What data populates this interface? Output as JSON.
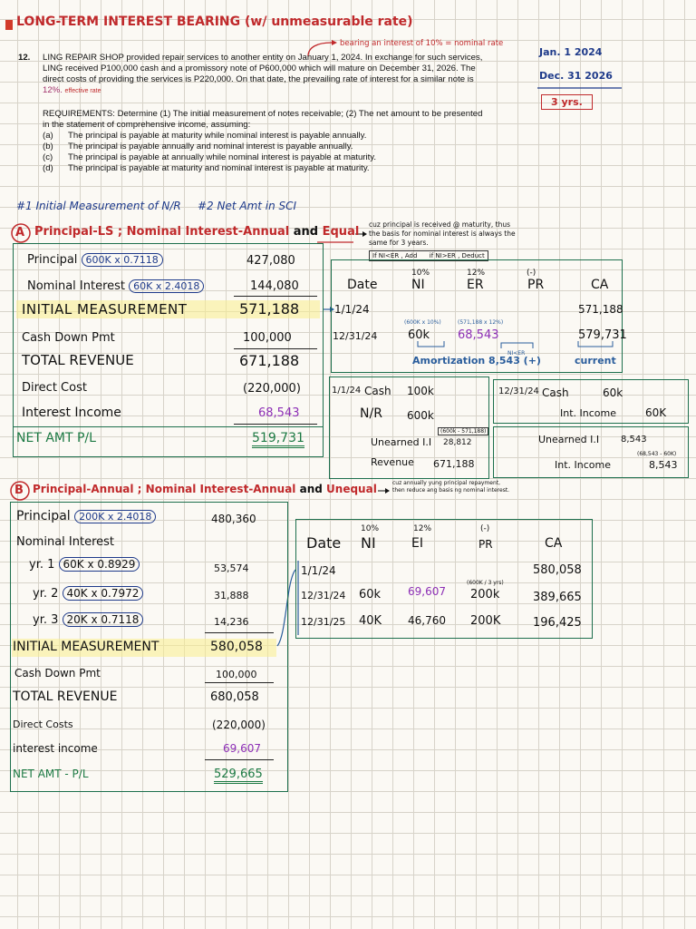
{
  "header": {
    "title": "LONG-TERM INTEREST BEARING",
    "subtitle": "(w/ unmeasurable rate)",
    "annotation": "bearing an interest of 10% = nominal rate",
    "dates": [
      "Jan. 1 2024",
      "Dec. 31 2026"
    ],
    "years": "3 yrs."
  },
  "problem": {
    "number": "12.",
    "lines": [
      "LING REPAIR SHOP provided repair services to another entity on January 1, 2024. In exchange for such services,",
      "LING received P100,000 cash and a promissory note of P600,000 which will mature on December 31, 2026. The",
      "direct costs of providing the services is P220,000. On that date, the prevailing rate of interest for a similar note is",
      "12%."
    ],
    "effective_note": "effective rate",
    "req_lines": [
      "REQUIREMENTS: Determine (1) The initial measurement of notes receivable; (2) The net amount to be presented",
      "in the statement of comprehensive income, assuming:"
    ],
    "options": [
      {
        "k": "(a)",
        "t": "The principal is payable at maturity while nominal interest is payable annually."
      },
      {
        "k": "(b)",
        "t": "The principal is payable annually and nominal interest is payable annually."
      },
      {
        "k": "(c)",
        "t": "The principal is payable at annually while nominal interest is payable at maturity."
      },
      {
        "k": "(d)",
        "t": "The principal is payable at maturity and nominal interest is payable at maturity."
      }
    ]
  },
  "section_headers": {
    "h1": "#1 Initial Measurement of N/R",
    "h2": "#2 Net Amt in SCI"
  },
  "partA": {
    "letter": "A",
    "title": "Principal-LS ; Nominal Interest-Annual",
    "and": "and",
    "equal": "Equal",
    "note": [
      "cuz principal is received @ maturity, thus",
      "the basis for nominal interest is always the",
      "same for 3 years."
    ],
    "mini_rule": [
      "If NI<ER , Add",
      "if NI>ER , Deduct"
    ],
    "rows": [
      {
        "label": "Principal",
        "calc": "600K x 0.7118",
        "value": "427,080"
      },
      {
        "label": "Nominal Interest",
        "calc": "60K x 2.4018",
        "value": "144,080"
      },
      {
        "label": "INITIAL MEASUREMENT",
        "value": "571,188"
      },
      {
        "label": "Cash Down Pmt",
        "value": "100,000"
      },
      {
        "label": "TOTAL REVENUE",
        "value": "671,188"
      },
      {
        "label": "Direct Cost",
        "value": "(220,000)"
      },
      {
        "label": "Interest Income",
        "value": "68,543"
      },
      {
        "label": "NET AMT P/L",
        "value": "519,731"
      }
    ],
    "amort": {
      "headers": [
        "Date",
        "NI",
        "ER",
        "PR",
        "CA"
      ],
      "rates": [
        "10%",
        "12%",
        "(-)"
      ],
      "rows": [
        {
          "date": "1/1/24",
          "ni": "",
          "er": "",
          "pr": "",
          "ca": "571,188"
        },
        {
          "date": "12/31/24",
          "ni": "60k",
          "er": "68,543",
          "pr": "",
          "ca": "579,731"
        }
      ],
      "ni_note": "(600K x 10%)",
      "er_note": "(571,188 x 12%)",
      "amort_label": "Amortization 8,543 (+)",
      "ni_er": "NI<ER",
      "current": "current"
    },
    "je1": [
      {
        "d": "1/1/24",
        "a": "Cash",
        "v": "100k"
      },
      {
        "d": "",
        "a": "N/R",
        "v": "600k"
      },
      {
        "d": "",
        "a": "Unearned I.I",
        "v": "28,812"
      },
      {
        "d": "",
        "a": "Revenue",
        "v": "671,188"
      }
    ],
    "je1_note": "(600k - 571,188)",
    "je2": [
      {
        "d": "12/31/24",
        "a": "Cash",
        "v": "60k"
      },
      {
        "d": "",
        "a": "Int. Income",
        "v": "60K"
      }
    ],
    "je3": [
      {
        "a": "Unearned I.I",
        "v": "8,543"
      },
      {
        "a": "Int. Income",
        "v": "8,543"
      }
    ],
    "je3_note": "(68,543 - 60K)"
  },
  "partB": {
    "letter": "B",
    "title": "Principal-Annual ; Nominal Interest-Annual",
    "and": "and",
    "unequal": "Unequal",
    "note": [
      "cuz annually yung principal repayment,",
      "then reduce ang basis ng nominal interest."
    ],
    "rows": [
      {
        "label": "Principal",
        "calc": "200K x 2.4018",
        "value": "480,360"
      },
      {
        "label": "Nominal Interest",
        "value": ""
      },
      {
        "label": "yr. 1",
        "calc": "60K x 0.8929",
        "value": "53,574"
      },
      {
        "label": "yr. 2",
        "calc": "40K x 0.7972",
        "value": "31,888"
      },
      {
        "label": "yr. 3",
        "calc": "20K x 0.7118",
        "value": "14,236"
      },
      {
        "label": "INITIAL MEASUREMENT",
        "value": "580,058"
      },
      {
        "label": "Cash Down Pmt",
        "value": "100,000"
      },
      {
        "label": "TOTAL REVENUE",
        "value": "680,058"
      },
      {
        "label": "Direct Costs",
        "value": "(220,000)"
      },
      {
        "label": "interest income",
        "value": "69,607"
      },
      {
        "label": "NET AMT - P/L",
        "value": "529,665"
      }
    ],
    "amort": {
      "headers": [
        "Date",
        "NI",
        "EI",
        "PR",
        "CA"
      ],
      "rates": [
        "10%",
        "12%",
        "(-)"
      ],
      "rows": [
        {
          "date": "1/1/24",
          "ni": "",
          "ei": "",
          "pr": "",
          "ca": "580,058"
        },
        {
          "date": "12/31/24",
          "ni": "60k",
          "ei": "69,607",
          "pr": "200k",
          "ca": "389,665"
        },
        {
          "date": "12/31/25",
          "ni": "40K",
          "ei": "46,760",
          "pr": "200K",
          "ca": "196,425"
        }
      ],
      "pr_note": "(600K / 3 yrs)"
    }
  }
}
